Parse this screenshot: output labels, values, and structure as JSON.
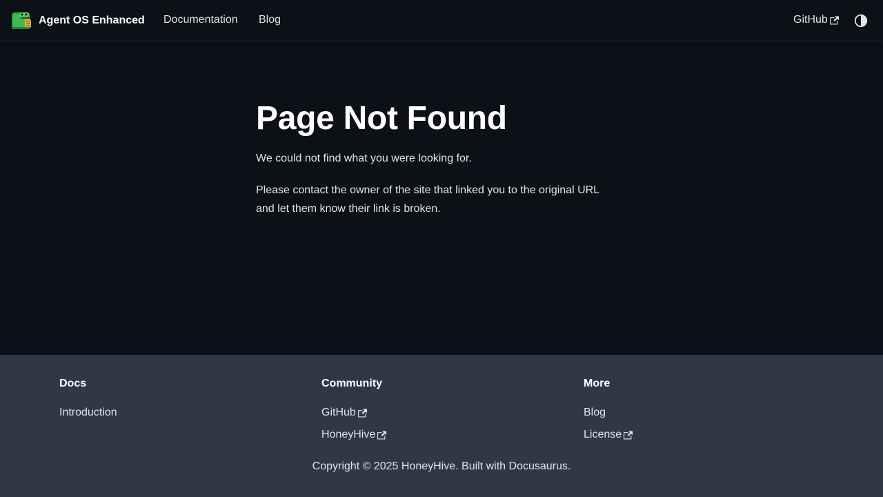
{
  "navbar": {
    "brand_title": "Agent OS Enhanced",
    "logo_icon": "dinosaur-logo-icon",
    "links": {
      "documentation": "Documentation",
      "blog": "Blog",
      "github": "GitHub"
    },
    "theme_toggle_icon": "half-circle-contrast-icon"
  },
  "main": {
    "title": "Page Not Found",
    "paragraph_1": "We could not find what you were looking for.",
    "paragraph_2": "Please contact the owner of the site that linked you to the original URL and let them know their link is broken."
  },
  "footer": {
    "columns": [
      {
        "title": "Docs",
        "links": [
          {
            "label": "Introduction",
            "external": false
          }
        ]
      },
      {
        "title": "Community",
        "links": [
          {
            "label": "GitHub",
            "external": true
          },
          {
            "label": "HoneyHive",
            "external": true
          }
        ]
      },
      {
        "title": "More",
        "links": [
          {
            "label": "Blog",
            "external": false
          },
          {
            "label": "License",
            "external": true
          }
        ]
      }
    ],
    "copyright": "Copyright © 2025 HoneyHive. Built with Docusaurus."
  },
  "colors": {
    "background": "#0d1017",
    "footer_background": "#303846",
    "text": "#e3e3e3",
    "heading": "#ffffff",
    "logo_green": "#3fb950"
  }
}
